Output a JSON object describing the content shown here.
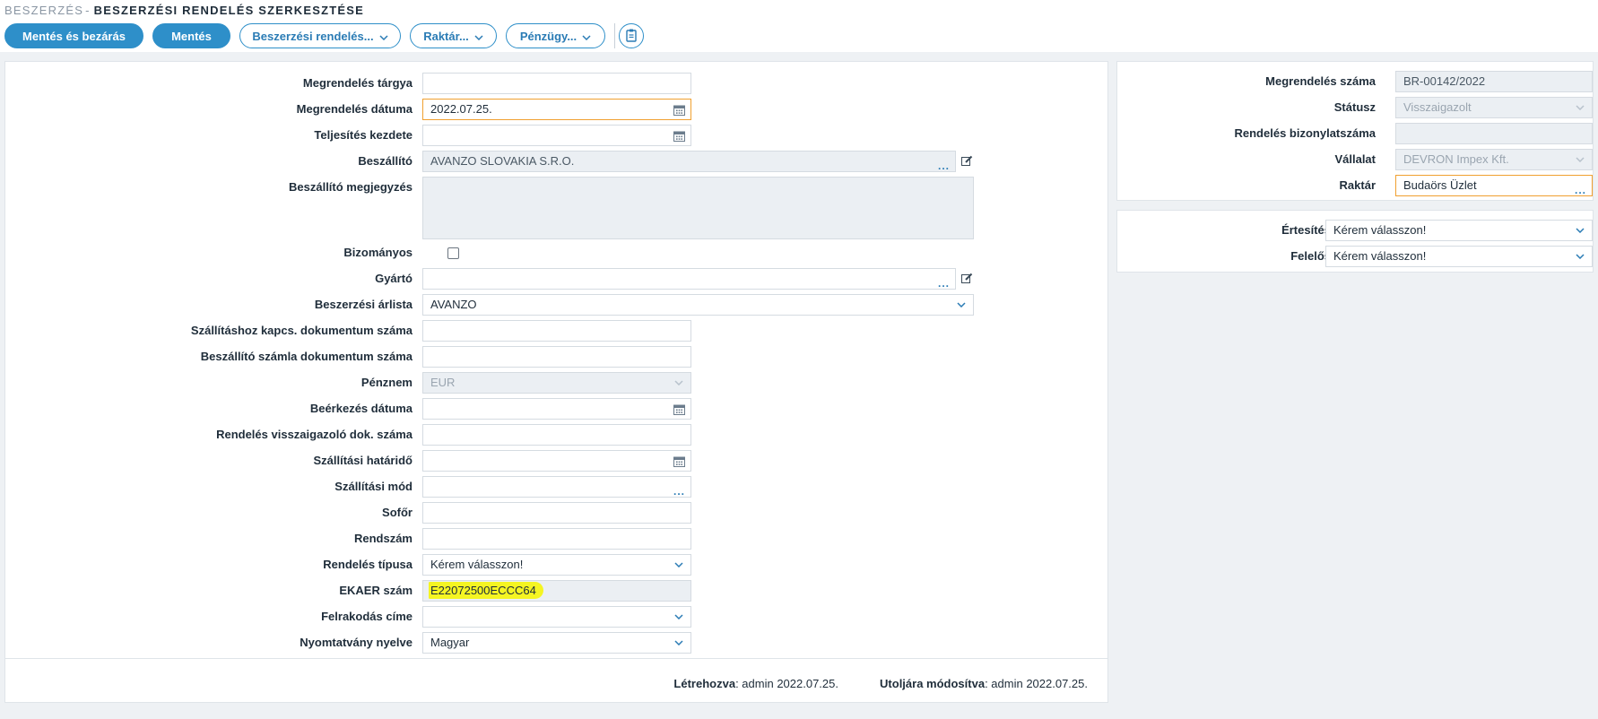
{
  "breadcrumb": {
    "root": "BESZERZÉS",
    "separator": "-",
    "current": "BESZERZÉSI RENDELÉS SZERKESZTÉSE"
  },
  "toolbar": {
    "save_close": "Mentés és bezárás",
    "save": "Mentés",
    "purchase_order_menu": "Beszerzési rendelés...",
    "warehouse_menu": "Raktár...",
    "finance_menu": "Pénzügy...",
    "clipboard_icon": "clipboard-icon"
  },
  "form": {
    "subject": {
      "label": "Megrendelés tárgya",
      "value": ""
    },
    "order_date": {
      "label": "Megrendelés dátuma",
      "value": "2022.07.25."
    },
    "fulfillment_start": {
      "label": "Teljesítés kezdete",
      "value": ""
    },
    "supplier": {
      "label": "Beszállító",
      "value": "AVANZO SLOVAKIA S.R.O."
    },
    "supplier_note": {
      "label": "Beszállító megjegyzés",
      "value": ""
    },
    "consignment": {
      "label": "Bizományos",
      "checked": false
    },
    "manufacturer": {
      "label": "Gyártó",
      "value": ""
    },
    "price_list": {
      "label": "Beszerzési árlista",
      "value": "AVANZO"
    },
    "shipping_doc_no": {
      "label": "Szállításhoz kapcs. dokumentum száma",
      "value": ""
    },
    "supplier_invoice_no": {
      "label": "Beszállító számla dokumentum száma",
      "value": ""
    },
    "currency": {
      "label": "Pénznem",
      "value": "EUR"
    },
    "arrival_date": {
      "label": "Beérkezés dátuma",
      "value": ""
    },
    "confirm_doc_no": {
      "label": "Rendelés visszaigazoló dok. száma",
      "value": ""
    },
    "delivery_deadline": {
      "label": "Szállítási határidő",
      "value": ""
    },
    "shipping_method": {
      "label": "Szállítási mód",
      "value": ""
    },
    "driver": {
      "label": "Sofőr",
      "value": ""
    },
    "plate_number": {
      "label": "Rendszám",
      "value": ""
    },
    "order_type": {
      "label": "Rendelés típusa",
      "value": "Kérem válasszon!"
    },
    "ekaer": {
      "label": "EKAER szám",
      "value": "E22072500ECCC64"
    },
    "loading_address": {
      "label": "Felrakodás címe",
      "value": ""
    },
    "print_language": {
      "label": "Nyomtatvány nyelve",
      "value": "Magyar"
    }
  },
  "side": {
    "order_number": {
      "label": "Megrendelés száma",
      "value": "BR-00142/2022"
    },
    "status": {
      "label": "Státusz",
      "value": "Visszaigazolt"
    },
    "order_doc_no": {
      "label": "Rendelés bizonylatszáma",
      "value": ""
    },
    "company": {
      "label": "Vállalat",
      "value": "DEVRON Impex Kft."
    },
    "warehouse": {
      "label": "Raktár",
      "value": "Budaörs Üzlet"
    },
    "notification": {
      "label": "Értesítés",
      "value": "Kérem válasszon!"
    },
    "responsible": {
      "label": "Felelős",
      "value": "Kérem válasszon!"
    }
  },
  "footer": {
    "created_label": "Létrehozva",
    "created_value": "admin 2022.07.25.",
    "modified_label": "Utoljára módosítva",
    "modified_value": "admin 2022.07.25."
  },
  "colors": {
    "accent": "#2e8fc9",
    "focus_border": "#f0a030",
    "highlight": "#f5f522"
  }
}
